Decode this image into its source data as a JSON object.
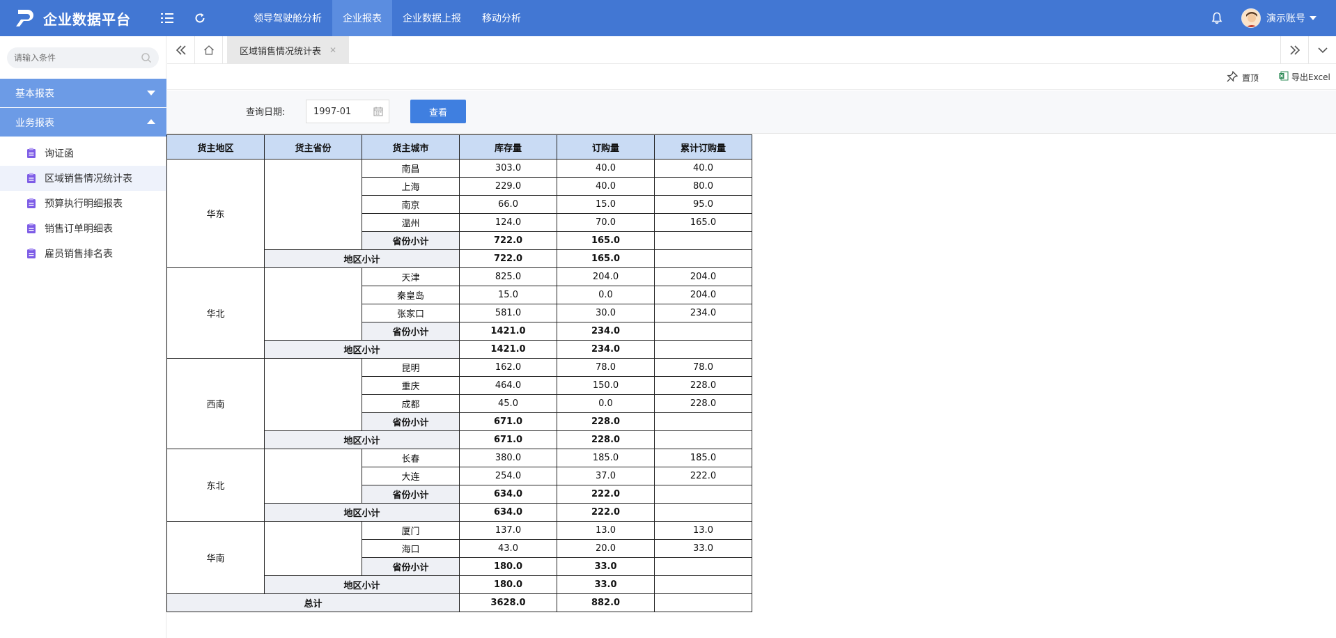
{
  "app": {
    "title": "企业数据平台"
  },
  "nav": {
    "items": [
      {
        "label": "领导驾驶舱分析",
        "active": false
      },
      {
        "label": "企业报表",
        "active": true
      },
      {
        "label": "企业数据上报",
        "active": false
      },
      {
        "label": "移动分析",
        "active": false
      }
    ]
  },
  "user": {
    "name": "演示账号"
  },
  "sidebar": {
    "search_placeholder": "请输入条件",
    "groups": [
      {
        "label": "基本报表",
        "expanded": false
      },
      {
        "label": "业务报表",
        "expanded": true
      }
    ],
    "items": [
      {
        "label": "询证函",
        "active": false
      },
      {
        "label": "区域销售情况统计表",
        "active": true
      },
      {
        "label": "预算执行明细报表",
        "active": false
      },
      {
        "label": "销售订单明细表",
        "active": false
      },
      {
        "label": "雇员销售排名表",
        "active": false
      }
    ]
  },
  "tabs": [
    {
      "label": "区域销售情况统计表"
    }
  ],
  "toolbar": {
    "pin_label": "置顶",
    "export_label": "导出Excel"
  },
  "query": {
    "date_label": "查询日期:",
    "date_value": "1997-01",
    "button_label": "查看"
  },
  "table": {
    "headers": [
      "货主地区",
      "货主省份",
      "货主城市",
      "库存量",
      "订购量",
      "累计订购量"
    ],
    "province_subtotal_label": "省份小计",
    "region_subtotal_label": "地区小计",
    "total_label": "总计",
    "regions": [
      {
        "name": "华东",
        "cities": [
          {
            "city": "南昌",
            "stock": "303.0",
            "order": "40.0",
            "cum": "40.0"
          },
          {
            "city": "上海",
            "stock": "229.0",
            "order": "40.0",
            "cum": "80.0"
          },
          {
            "city": "南京",
            "stock": "66.0",
            "order": "15.0",
            "cum": "95.0"
          },
          {
            "city": "温州",
            "stock": "124.0",
            "order": "70.0",
            "cum": "165.0"
          }
        ],
        "province_subtotal": {
          "stock": "722.0",
          "order": "165.0"
        },
        "region_subtotal": {
          "stock": "722.0",
          "order": "165.0"
        }
      },
      {
        "name": "华北",
        "cities": [
          {
            "city": "天津",
            "stock": "825.0",
            "order": "204.0",
            "cum": "204.0"
          },
          {
            "city": "秦皇岛",
            "stock": "15.0",
            "order": "0.0",
            "cum": "204.0"
          },
          {
            "city": "张家口",
            "stock": "581.0",
            "order": "30.0",
            "cum": "234.0"
          }
        ],
        "province_subtotal": {
          "stock": "1421.0",
          "order": "234.0"
        },
        "region_subtotal": {
          "stock": "1421.0",
          "order": "234.0"
        }
      },
      {
        "name": "西南",
        "cities": [
          {
            "city": "昆明",
            "stock": "162.0",
            "order": "78.0",
            "cum": "78.0"
          },
          {
            "city": "重庆",
            "stock": "464.0",
            "order": "150.0",
            "cum": "228.0"
          },
          {
            "city": "成都",
            "stock": "45.0",
            "order": "0.0",
            "cum": "228.0"
          }
        ],
        "province_subtotal": {
          "stock": "671.0",
          "order": "228.0"
        },
        "region_subtotal": {
          "stock": "671.0",
          "order": "228.0"
        }
      },
      {
        "name": "东北",
        "cities": [
          {
            "city": "长春",
            "stock": "380.0",
            "order": "185.0",
            "cum": "185.0"
          },
          {
            "city": "大连",
            "stock": "254.0",
            "order": "37.0",
            "cum": "222.0"
          }
        ],
        "province_subtotal": {
          "stock": "634.0",
          "order": "222.0"
        },
        "region_subtotal": {
          "stock": "634.0",
          "order": "222.0"
        }
      },
      {
        "name": "华南",
        "cities": [
          {
            "city": "厦门",
            "stock": "137.0",
            "order": "13.0",
            "cum": "13.0"
          },
          {
            "city": "海口",
            "stock": "43.0",
            "order": "20.0",
            "cum": "33.0"
          }
        ],
        "province_subtotal": {
          "stock": "180.0",
          "order": "33.0"
        },
        "region_subtotal": {
          "stock": "180.0",
          "order": "33.0"
        }
      }
    ],
    "total": {
      "stock": "3628.0",
      "order": "882.0"
    }
  }
}
